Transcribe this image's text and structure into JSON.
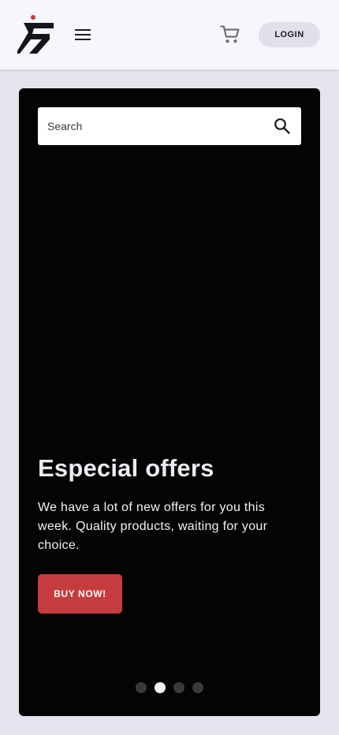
{
  "header": {
    "logo_icon": "brand-runner-logo",
    "menu_icon": "hamburger-menu-icon",
    "cart_icon": "shopping-cart-icon",
    "login_label": "LOGIN"
  },
  "hero": {
    "search": {
      "placeholder": "Search",
      "icon": "search-icon"
    },
    "title": "Especial offers",
    "description": "We have a lot of new offers for you this week. Quality products, waiting for your choice.",
    "cta_label": "BUY NOW!",
    "carousel": {
      "slide_count": 4,
      "active_slide": 2
    }
  },
  "colors": {
    "header_bg": "#f6f6fc",
    "page_bg": "#e4e4ef",
    "hero_bg": "#040404",
    "accent_red": "#c63c3e",
    "logo_dark": "#15151c",
    "login_bg": "#e0e0eb"
  }
}
